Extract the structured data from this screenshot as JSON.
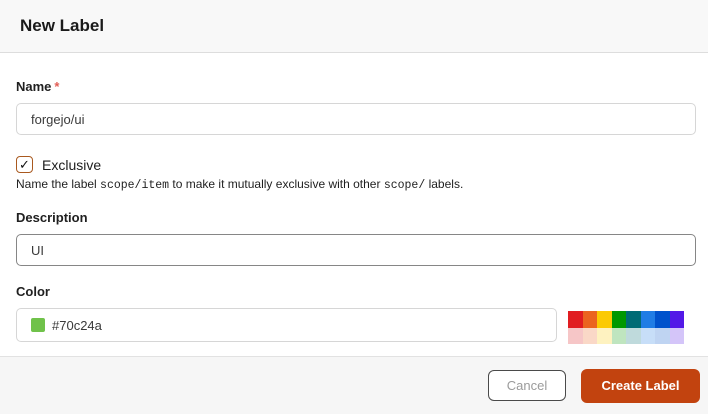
{
  "dialog": {
    "title": "New Label"
  },
  "form": {
    "name": {
      "label": "Name",
      "required_marker": "*",
      "value": "forgejo/ui"
    },
    "exclusive": {
      "label": "Exclusive",
      "checked": true,
      "checkmark": "✓",
      "help_prefix": "Name the label ",
      "help_code1": "scope/item",
      "help_middle": " to make it mutually exclusive with other ",
      "help_code2": "scope/",
      "help_suffix": " labels."
    },
    "description": {
      "label": "Description",
      "value": "UI"
    },
    "color": {
      "label": "Color",
      "value": "#70c24a",
      "swatch_color": "#70c24a",
      "palette": [
        "#e11d21",
        "#eb6420",
        "#fbca04",
        "#009800",
        "#006b75",
        "#207de5",
        "#0052cc",
        "#5319e7",
        "#f6c6c7",
        "#fad8c7",
        "#fef2c0",
        "#bfe5bf",
        "#bfdadc",
        "#c7def8",
        "#bfd4f2",
        "#d4c5f9"
      ]
    }
  },
  "footer": {
    "cancel_label": "Cancel",
    "create_label": "Create Label"
  },
  "colors": {
    "primary_button": "#c2430f",
    "required_asterisk": "#e25d55"
  }
}
